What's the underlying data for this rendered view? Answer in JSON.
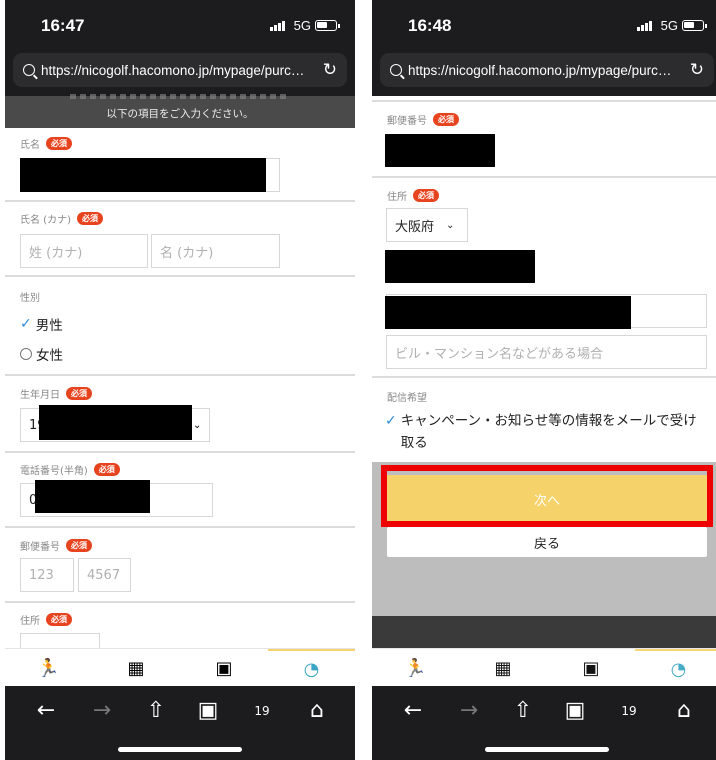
{
  "left": {
    "status": {
      "time": "16:47",
      "network": "5G"
    },
    "browser": {
      "url": "https://nicogolf.hacomono.jp/mypage/purc…"
    },
    "notice": "以下の項目をご入力ください。",
    "required_badge": "必須",
    "form": {
      "name_label": "氏名",
      "kana_label": "氏名 (カナ)",
      "kana_last_placeholder": "姓 (カナ)",
      "kana_first_placeholder": "名 (カナ)",
      "gender_label": "性別",
      "gender_male": "男性",
      "gender_female": "女性",
      "birth_label": "生年月日",
      "birth_value": "19",
      "phone_label": "電話番号(半角)",
      "phone_value": "0",
      "postal_label": "郵便番号",
      "postal_first_placeholder": "123",
      "postal_second_placeholder": "4567",
      "address_label": "住所"
    }
  },
  "right": {
    "status": {
      "time": "16:48",
      "network": "5G"
    },
    "browser": {
      "url": "https://nicogolf.hacomono.jp/mypage/purc…"
    },
    "required_badge": "必須",
    "form": {
      "postal_label": "郵便番号",
      "address_label": "住所",
      "prefecture_value": "大阪府",
      "building_placeholder": "ビル・マンション名などがある場合",
      "delivery_label": "配信希望",
      "delivery_option": "キャンペーン・お知らせ等の情報をメールで受け取る"
    },
    "buttons": {
      "next": "次へ",
      "back": "戻る"
    }
  },
  "icons": {
    "tabbar": [
      "runner-icon",
      "calendar-icon",
      "qr-code-icon",
      "user-icon"
    ],
    "toolbar": [
      "back-arrow-icon",
      "forward-arrow-icon",
      "share-icon",
      "bookmarks-icon",
      "tabs-icon",
      "home-icon"
    ],
    "tabs_count": "19"
  },
  "colors": {
    "required": "#e8431f",
    "next_button": "#f6d36a",
    "highlight": "#ee0000",
    "check": "#2b8ad8",
    "active_tab": "#3aa6c3"
  }
}
